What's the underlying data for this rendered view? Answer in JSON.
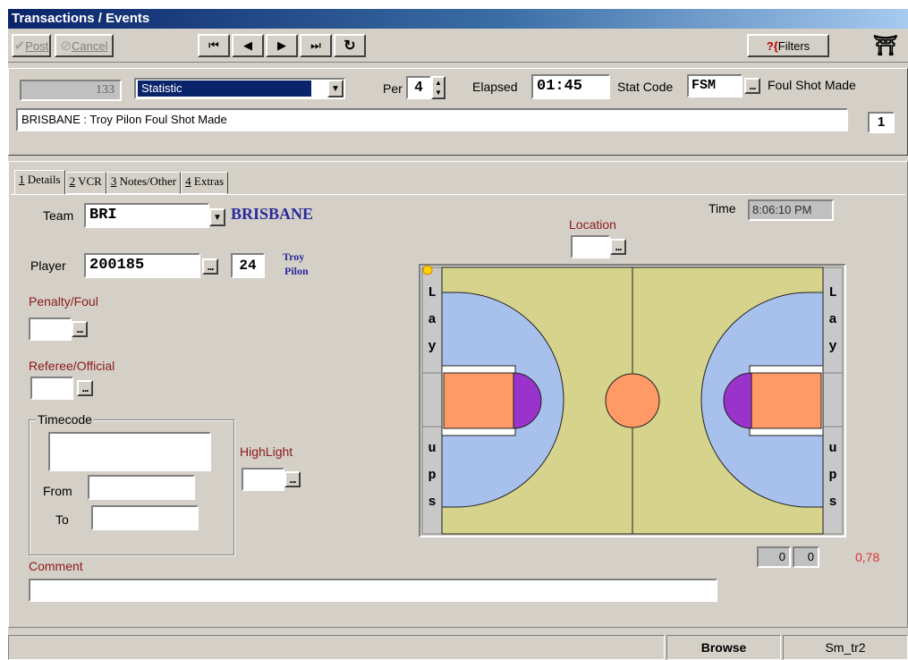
{
  "window": {
    "title": "Transactions / Events"
  },
  "toolbar": {
    "post_label": "Post",
    "cancel_label": "Cancel",
    "filters_label": "Filters"
  },
  "event": {
    "number": "133",
    "type_value": "Statistic",
    "per_label": "Per",
    "per_value": "4",
    "elapsed_label": "Elapsed",
    "elapsed_value": "01:45",
    "stat_code_label": "Stat Code",
    "stat_code_value": "FSM",
    "stat_code_desc": "Foul Shot Made",
    "description": "BRISBANE : Troy Pilon  Foul Shot Made",
    "count": "1"
  },
  "tabs": [
    {
      "key": "1",
      "label": " Details"
    },
    {
      "key": "2",
      "label": " VCR"
    },
    {
      "key": "3",
      "label": " Notes/Other"
    },
    {
      "key": "4",
      "label": " Extras"
    }
  ],
  "details": {
    "team_label": "Team",
    "team_code": "BRI",
    "team_name": "BRISBANE",
    "player_label": "Player",
    "player_id": "200185",
    "player_number": "24",
    "player_first": "Troy",
    "player_last": "Pilon",
    "penalty_label": "Penalty/Foul",
    "referee_label": "Referee/Official",
    "timecode_label": "Timecode",
    "from_label": "From",
    "to_label": "To",
    "highlight_label": "HighLight",
    "location_label": "Location",
    "time_label": "Time",
    "time_value": "8:06:10 PM",
    "comment_label": "Comment",
    "score_a": "0",
    "score_b": "0",
    "ratio": "0,78"
  },
  "court": {
    "left_letters_top": [
      "L",
      "a",
      "y"
    ],
    "left_letters_bottom": [
      "u",
      "p",
      "s"
    ],
    "right_letters_top": [
      "L",
      "a",
      "y"
    ],
    "right_letters_bottom": [
      "u",
      "p",
      "s"
    ],
    "colors": {
      "floor": "#d6d48c",
      "arc": "#a8c0ec",
      "key": "#ff9a66",
      "restricted": "#9933cc",
      "side": "#c8c8c8"
    }
  },
  "status": {
    "mode": "Browse",
    "form": "Sm_tr2"
  }
}
